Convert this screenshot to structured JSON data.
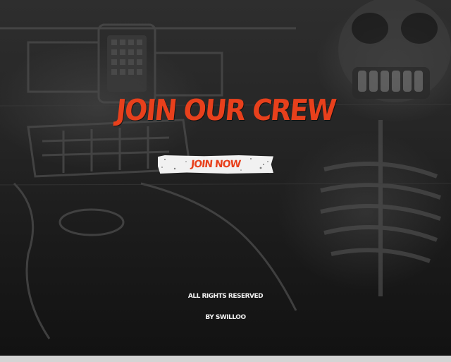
{
  "hero": {
    "title": "JOIN OUR CREW",
    "button_label": "JOIN NOW"
  },
  "footer": {
    "rights": "ALL RIGHTS RESERVED",
    "credit": "BY SWILLOO"
  },
  "colors": {
    "accent": "#e8401c",
    "button_bg": "#f1f1f1",
    "footer_text": "#f0f0f0",
    "background": "#1b1b1b"
  },
  "background_image": "graffiti-skeleton-mural"
}
